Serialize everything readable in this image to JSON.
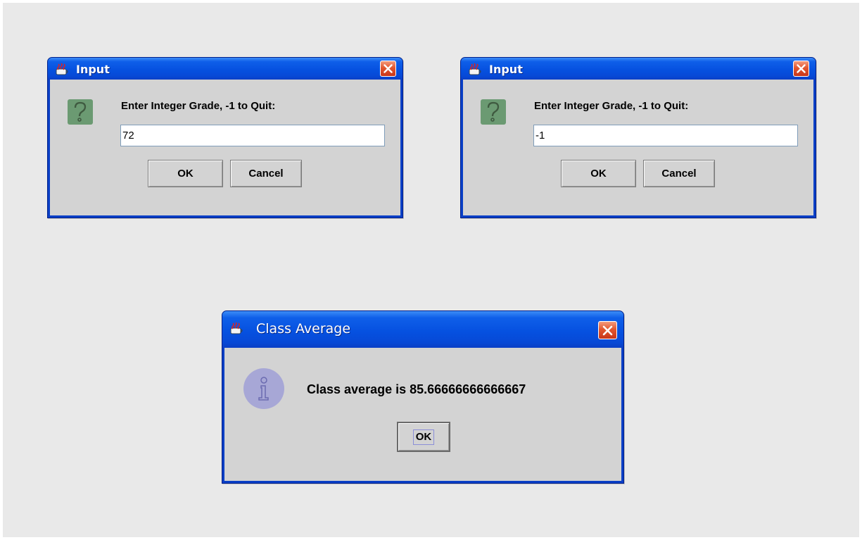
{
  "dialogs": [
    {
      "title": "Input",
      "prompt": "Enter Integer Grade, -1 to Quit:",
      "input_value": "72",
      "ok_label": "OK",
      "cancel_label": "Cancel"
    },
    {
      "title": "Input",
      "prompt": "Enter Integer Grade, -1 to Quit:",
      "input_value": "-1",
      "ok_label": "OK",
      "cancel_label": "Cancel"
    }
  ],
  "result_dialog": {
    "title": "Class Average",
    "message": "Class average is 85.66666666666667",
    "ok_label": "OK"
  },
  "icons": {
    "title_icon": "java-coffee-cup-icon",
    "close_icon": "close-icon",
    "question_icon": "question-icon",
    "info_icon": "information-icon"
  },
  "colors": {
    "title_bar": "#0651e0",
    "close_button": "#e2562f",
    "dialog_body": "#d3d3d3",
    "question_icon_bg": "#6b9a72",
    "info_icon_bg": "#a7a7d6"
  }
}
